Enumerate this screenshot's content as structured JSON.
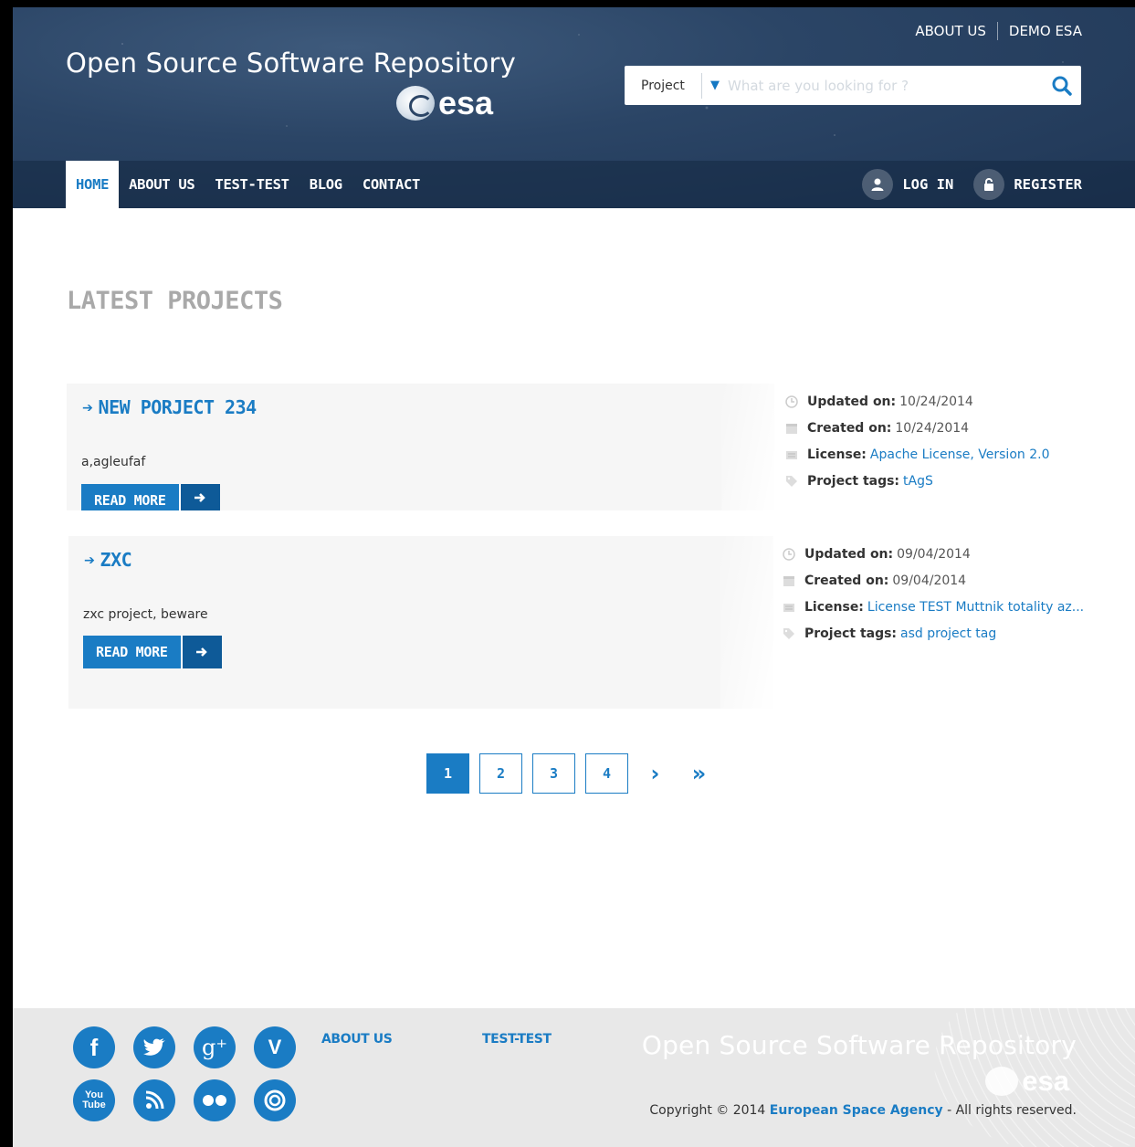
{
  "header": {
    "site_title": "Open Source Software Repository",
    "logo_word": "esa",
    "top_links": [
      "ABOUT US",
      "DEMO ESA"
    ],
    "search": {
      "scope": "Project",
      "placeholder": "What are you looking for ?",
      "value": ""
    },
    "nav": [
      "HOME",
      "ABOUT US",
      "TEST-TEST",
      "BLOG",
      "CONTACT"
    ],
    "active_nav": "HOME",
    "auth": {
      "login": "LOG IN",
      "register": "REGISTER"
    }
  },
  "main": {
    "section_title": "LATEST PROJECTS",
    "projects": [
      {
        "title": "NEW PORJECT 234",
        "description": "a,agleufaf",
        "read_more": "READ MORE",
        "meta": {
          "updated_label": "Updated on:",
          "updated": "10/24/2014",
          "created_label": "Created on:",
          "created": "10/24/2014",
          "license_label": "License:",
          "license": "Apache License, Version 2.0",
          "tags_label": "Project tags:",
          "tags": "tAgS"
        }
      },
      {
        "title": "ZXC",
        "description": "zxc project, beware",
        "read_more": "READ MORE",
        "meta": {
          "updated_label": "Updated on:",
          "updated": "09/04/2014",
          "created_label": "Created on:",
          "created": "09/04/2014",
          "license_label": "License:",
          "license": "License TEST Muttnik totality az...",
          "tags_label": "Project tags:",
          "tags": "asd project tag"
        }
      }
    ],
    "pagination": {
      "pages": [
        "1",
        "2",
        "3",
        "4"
      ],
      "current": "1",
      "next": "›",
      "last": "»"
    }
  },
  "footer": {
    "social": [
      "facebook-icon",
      "twitter-icon",
      "google-plus-icon",
      "vine-icon",
      "youtube-icon",
      "blog-icon",
      "flickr-icon",
      "instagram-icon"
    ],
    "links": [
      "ABOUT US",
      "TEST-TEST"
    ],
    "title": "Open Source Software Repository",
    "logo_word": "esa",
    "copyright_prefix": "Copyright © 2014",
    "copyright_org": "European Space Agency",
    "copyright_suffix": "- All rights reserved."
  },
  "colors": {
    "accent": "#1a7cc4",
    "accent_dark": "#0e5a98",
    "header_bg": "#2b4566",
    "footer_bg": "#e8e8e8"
  }
}
